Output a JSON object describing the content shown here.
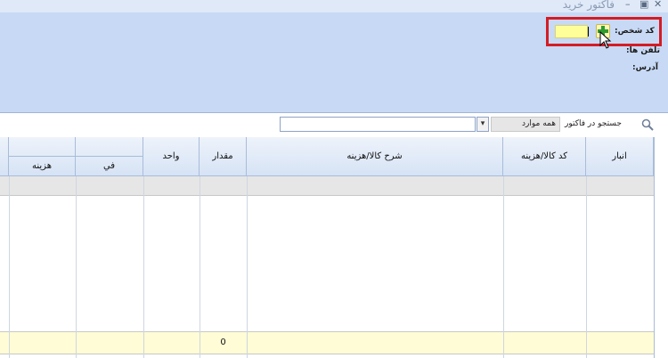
{
  "window": {
    "title": "فاکتور خرید",
    "minimize_glyph": "–",
    "restore_glyph": "▣",
    "close_glyph": "✕"
  },
  "header": {
    "code_label": "کد شخص:",
    "code_value": "",
    "phones_label": "تلفن ها:",
    "address_label": "آدرس:",
    "add_icon": "plus-icon"
  },
  "search": {
    "label": "جستجو در فاکتور",
    "scope_value": "همه موارد",
    "query": "",
    "icon": "search-icon"
  },
  "grid": {
    "columns": {
      "warehouse": "انبار",
      "item_code": "کد کالا/هزینه",
      "description": "شرح کالا/هزینه",
      "quantity": "مقدار",
      "unit": "واحد",
      "unit_price": "في",
      "cost": "هزینه"
    },
    "totals": {
      "quantity": "0"
    }
  },
  "colors": {
    "header_panel": "#c7d9f5",
    "code_input": "#ffff9a",
    "highlight": "#d41c24",
    "totals_row": "#fffcd6"
  }
}
